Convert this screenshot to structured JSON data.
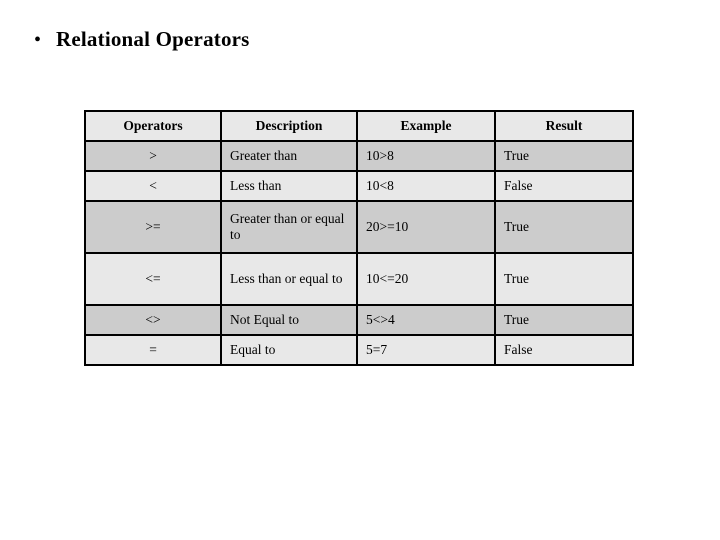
{
  "slide": {
    "title": "Relational Operators",
    "bullet_glyph": "•"
  },
  "table": {
    "headers": [
      "Operators",
      "Description",
      "Example",
      "Result"
    ],
    "rows": [
      {
        "operator": ">",
        "description": "Greater than",
        "example": "10>8",
        "result": "True"
      },
      {
        "operator": "<",
        "description": "Less than",
        "example": "10<8",
        "result": "False"
      },
      {
        "operator": ">=",
        "description": "Greater than or equal to",
        "example": "20>=10",
        "result": "True"
      },
      {
        "operator": "<=",
        "description": "Less than or equal to",
        "example": "10<=20",
        "result": "True"
      },
      {
        "operator": "<>",
        "description": "Not Equal to",
        "example": "5<>4",
        "result": "True"
      },
      {
        "operator": "=",
        "description": "Equal to",
        "example": "5=7",
        "result": "False"
      }
    ]
  },
  "colors": {
    "page_background": "#ffffff",
    "row_light": "#e8e8e8",
    "row_dark": "#cccccc",
    "border": "#000000",
    "text": "#000000"
  }
}
